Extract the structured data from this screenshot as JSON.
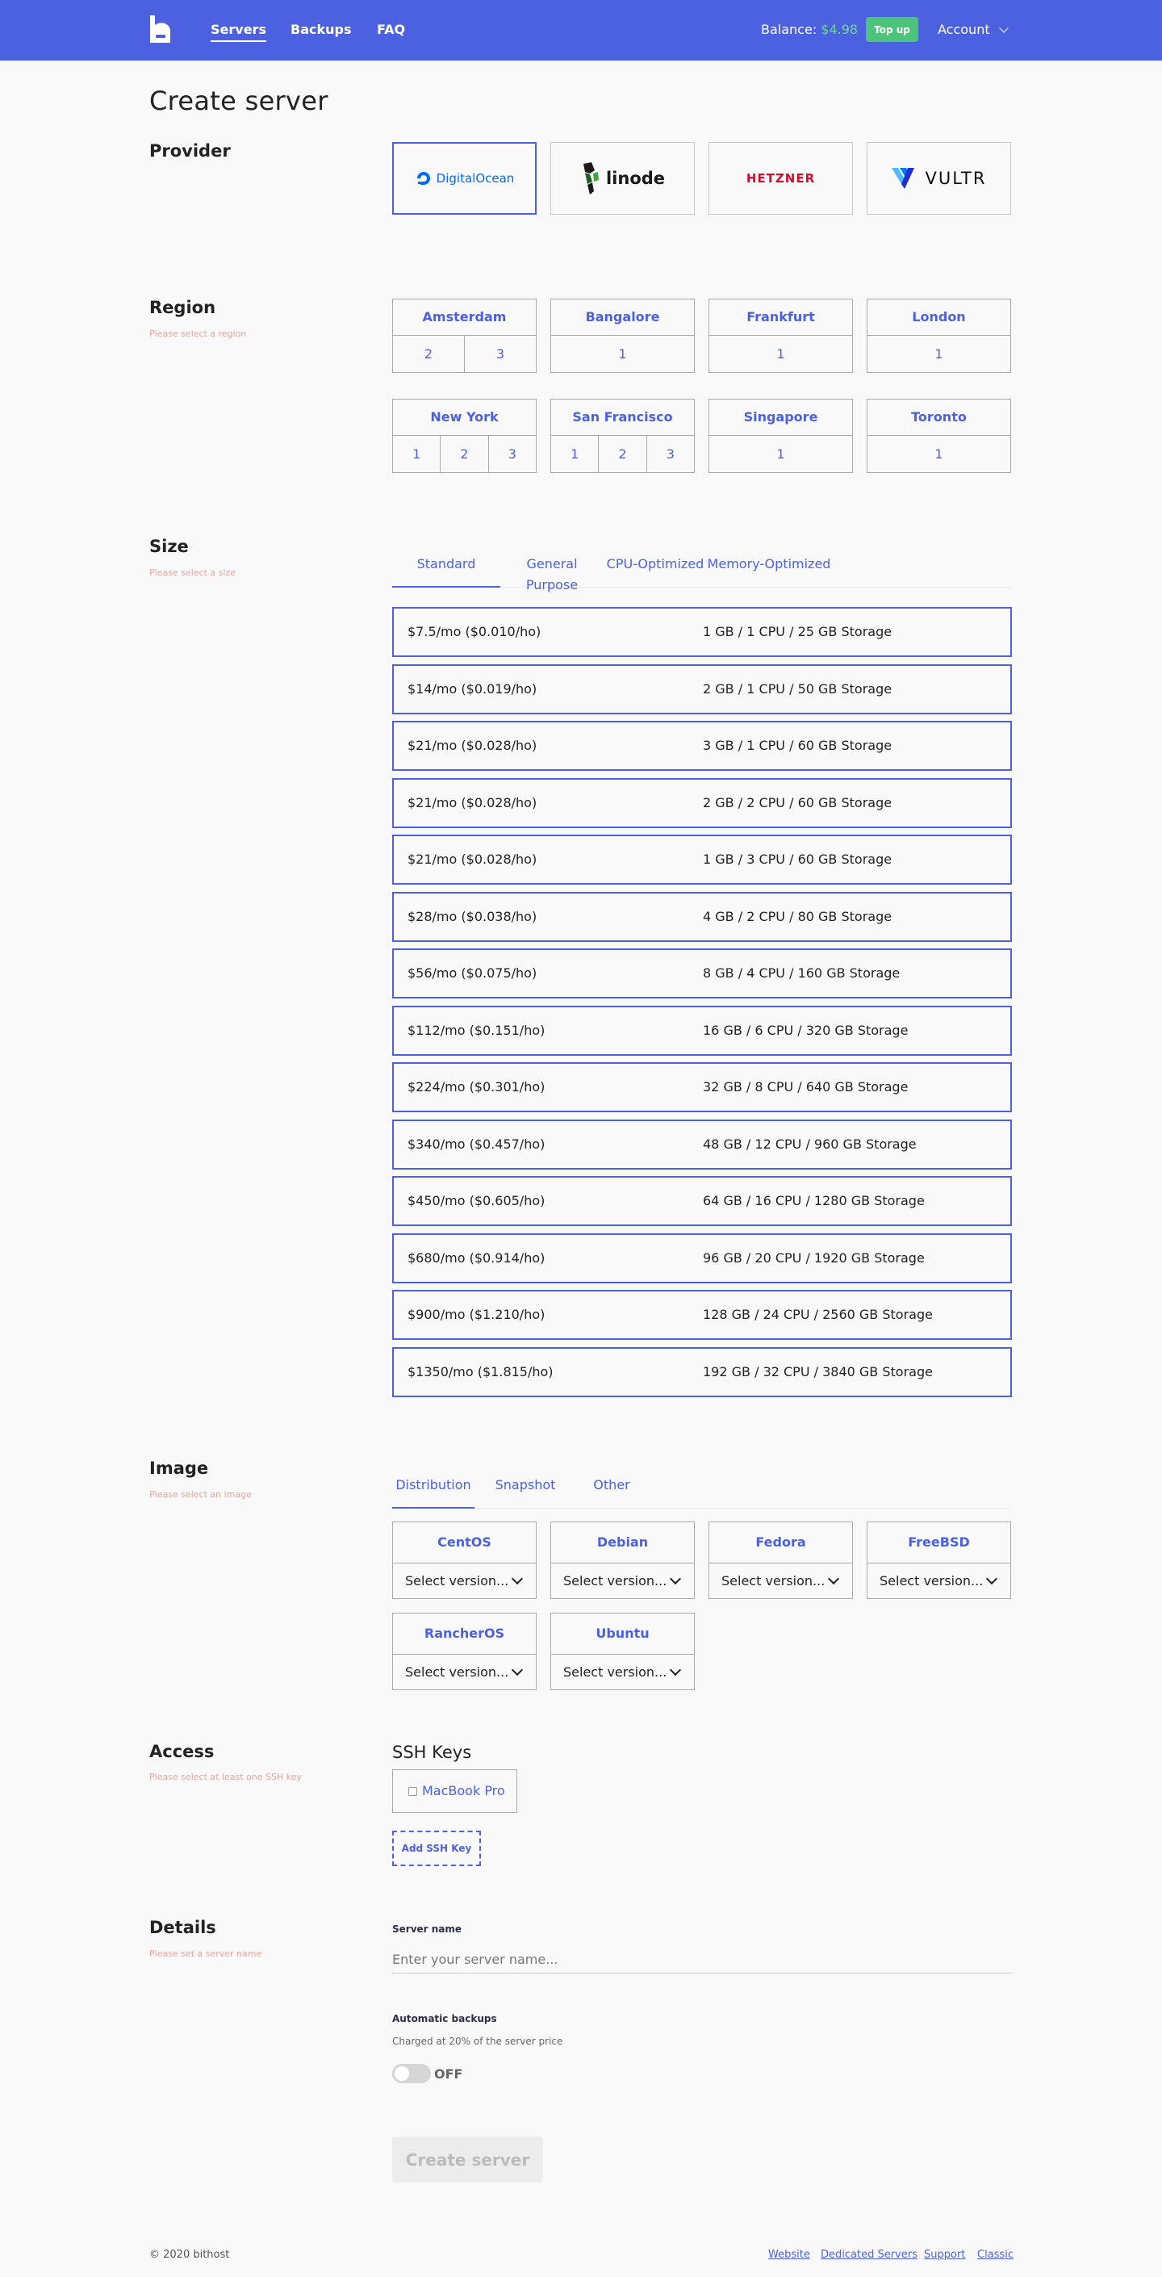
{
  "nav": {
    "items": [
      "Servers",
      "Backups",
      "FAQ"
    ],
    "balance_label": "Balance:",
    "balance_amount": "$4.98",
    "topup_label": "Top up",
    "account_label": "Account"
  },
  "page_title": "Create server",
  "provider": {
    "title": "Provider",
    "options": [
      "DigitalOcean",
      "linode",
      "HETZNER",
      "VULTR"
    ],
    "selected": "DigitalOcean",
    "brand_colors": {
      "DigitalOcean": "#0069ff",
      "linode": "#1a1a1a",
      "HETZNER": "#d50c2d",
      "VULTR": "#111111"
    }
  },
  "region": {
    "title": "Region",
    "hint": "Please select a region",
    "items": [
      {
        "name": "Amsterdam",
        "nums": [
          "2",
          "3"
        ]
      },
      {
        "name": "Bangalore",
        "nums": [
          "1"
        ]
      },
      {
        "name": "Frankfurt",
        "nums": [
          "1"
        ]
      },
      {
        "name": "London",
        "nums": [
          "1"
        ]
      },
      {
        "name": "New York",
        "nums": [
          "1",
          "2",
          "3"
        ]
      },
      {
        "name": "San Francisco",
        "nums": [
          "1",
          "2",
          "3"
        ]
      },
      {
        "name": "Singapore",
        "nums": [
          "1"
        ]
      },
      {
        "name": "Toronto",
        "nums": [
          "1"
        ]
      }
    ]
  },
  "size": {
    "title": "Size",
    "hint": "Please select a size",
    "tabs": [
      "Standard",
      "General Purpose",
      "CPU-Optimized",
      "Memory-Optimized"
    ],
    "active_tab": "Standard",
    "rows": [
      {
        "price": "$7.5/mo ($0.010/ho)",
        "spec": "1 GB / 1 CPU / 25 GB Storage"
      },
      {
        "price": "$14/mo ($0.019/ho)",
        "spec": "2 GB / 1 CPU / 50 GB Storage"
      },
      {
        "price": "$21/mo ($0.028/ho)",
        "spec": "3 GB / 1 CPU / 60 GB Storage"
      },
      {
        "price": "$21/mo ($0.028/ho)",
        "spec": "2 GB / 2 CPU / 60 GB Storage"
      },
      {
        "price": "$21/mo ($0.028/ho)",
        "spec": "1 GB / 3 CPU / 60 GB Storage"
      },
      {
        "price": "$28/mo ($0.038/ho)",
        "spec": "4 GB / 2 CPU / 80 GB Storage"
      },
      {
        "price": "$56/mo ($0.075/ho)",
        "spec": "8 GB / 4 CPU / 160 GB Storage"
      },
      {
        "price": "$112/mo ($0.151/ho)",
        "spec": "16 GB / 6 CPU / 320 GB Storage"
      },
      {
        "price": "$224/mo ($0.301/ho)",
        "spec": "32 GB / 8 CPU / 640 GB Storage"
      },
      {
        "price": "$340/mo ($0.457/ho)",
        "spec": "48 GB / 12 CPU / 960 GB Storage"
      },
      {
        "price": "$450/mo ($0.605/ho)",
        "spec": "64 GB / 16 CPU / 1280 GB Storage"
      },
      {
        "price": "$680/mo ($0.914/ho)",
        "spec": "96 GB / 20 CPU / 1920 GB Storage"
      },
      {
        "price": "$900/mo ($1.210/ho)",
        "spec": "128 GB / 24 CPU / 2560 GB Storage"
      },
      {
        "price": "$1350/mo ($1.815/ho)",
        "spec": "192 GB / 32 CPU / 3840 GB Storage"
      }
    ]
  },
  "image": {
    "title": "Image",
    "hint": "Please select an image",
    "tabs": [
      "Distribution",
      "Snapshot",
      "Other"
    ],
    "active_tab": "Distribution",
    "items": [
      {
        "name": "CentOS",
        "select": "Select version..."
      },
      {
        "name": "Debian",
        "select": "Select version..."
      },
      {
        "name": "Fedora",
        "select": "Select version..."
      },
      {
        "name": "FreeBSD",
        "select": "Select version..."
      },
      {
        "name": "RancherOS",
        "select": "Select version..."
      },
      {
        "name": "Ubuntu",
        "select": "Select version..."
      }
    ]
  },
  "access": {
    "title": "Access",
    "hint": "Please select at least one SSH key",
    "ssh_title": "SSH Keys",
    "keys": [
      "MacBook Pro"
    ],
    "add_label": "Add SSH Key"
  },
  "details": {
    "title": "Details",
    "hint": "Please set a server name",
    "server_name_label": "Server name",
    "server_name_placeholder": "Enter your server name...",
    "server_name_value": "",
    "backups_label": "Automatic backups",
    "backups_hint": "Charged at 20% of the server price",
    "backups_state": "OFF",
    "create_label": "Create server"
  },
  "footer": {
    "copyright": "© 2020 bithost",
    "links": [
      "Website",
      "Dedicated Servers",
      "Support",
      "Classic"
    ]
  },
  "colors": {
    "accent": "#4b61e0",
    "success": "#4cc37b",
    "hint": "#e4a59d"
  }
}
